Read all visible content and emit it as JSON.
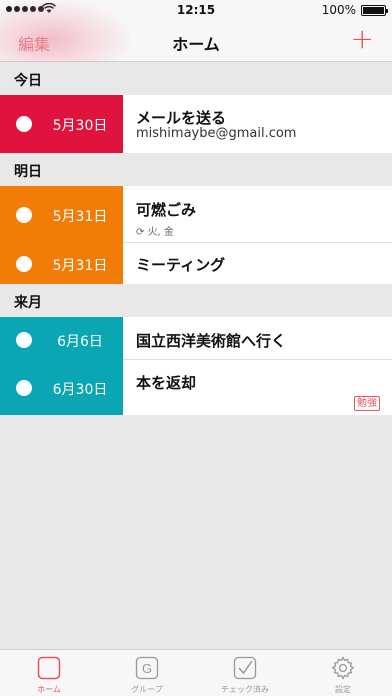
{
  "status_bar": {
    "time": "12:15",
    "battery": "100%"
  },
  "nav": {
    "edit_label": "編集",
    "title": "ホーム",
    "add_label": "+"
  },
  "sections": [
    {
      "header": "今日",
      "items": [
        {
          "date": "5月30日",
          "title": "メールを送る",
          "subtitle": "mishimaybe@gmail.com",
          "color": "#e0133f"
        }
      ]
    },
    {
      "header": "明日",
      "items": [
        {
          "date": "5月31日",
          "title": "可燃ごみ",
          "repeat": "火, 金",
          "color": "#f17c08"
        },
        {
          "date": "5月31日",
          "title": "ミーティング",
          "color": "#f17c08"
        }
      ]
    },
    {
      "header": "来月",
      "items": [
        {
          "date": "6月6日",
          "title": "国立西洋美術館へ行く",
          "color": "#0aa6b4"
        },
        {
          "date": "6月30日",
          "title": "本を返却",
          "tag": "勉強",
          "color": "#0aa6b4"
        }
      ]
    }
  ],
  "tabs": [
    {
      "label": "ホーム",
      "icon": "home-square-icon",
      "active": true
    },
    {
      "label": "グループ",
      "icon": "group-g-icon",
      "active": false
    },
    {
      "label": "チェック済み",
      "icon": "checkmark-icon",
      "active": false
    },
    {
      "label": "設定",
      "icon": "gear-icon",
      "active": false
    }
  ],
  "colors": {
    "accent": "#e8505b",
    "today": "#e0133f",
    "tomorrow": "#f17c08",
    "next_month": "#0aa6b4"
  }
}
